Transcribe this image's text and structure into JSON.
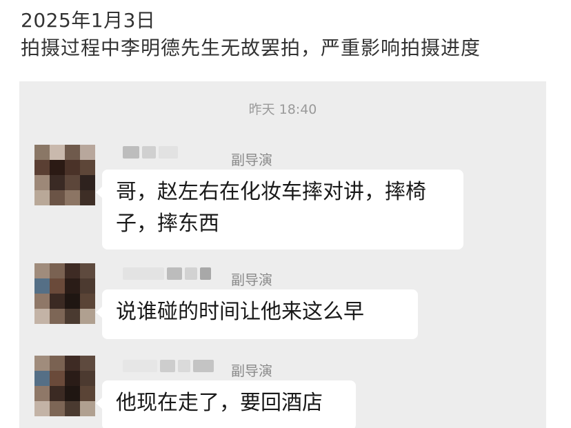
{
  "caption": {
    "date": "2025年1月3日",
    "text": "拍摄过程中李明德先生无故罢拍，严重影响拍摄进度"
  },
  "chat": {
    "timestamp": "昨天 18:40",
    "messages": [
      {
        "role": "副导演",
        "text_line1": "哥，赵左右在化妆车摔对讲，摔椅",
        "text_line2": "子，摔东西"
      },
      {
        "role": "副导演",
        "text": "说谁碰的时间让他来这么早"
      },
      {
        "role": "副导演",
        "text": "他现在走了，要回酒店"
      }
    ]
  },
  "colors": {
    "chat_background": "#ededed",
    "bubble": "#ffffff",
    "role_text": "#8a8a8a",
    "timestamp_text": "#9a9a9a"
  }
}
